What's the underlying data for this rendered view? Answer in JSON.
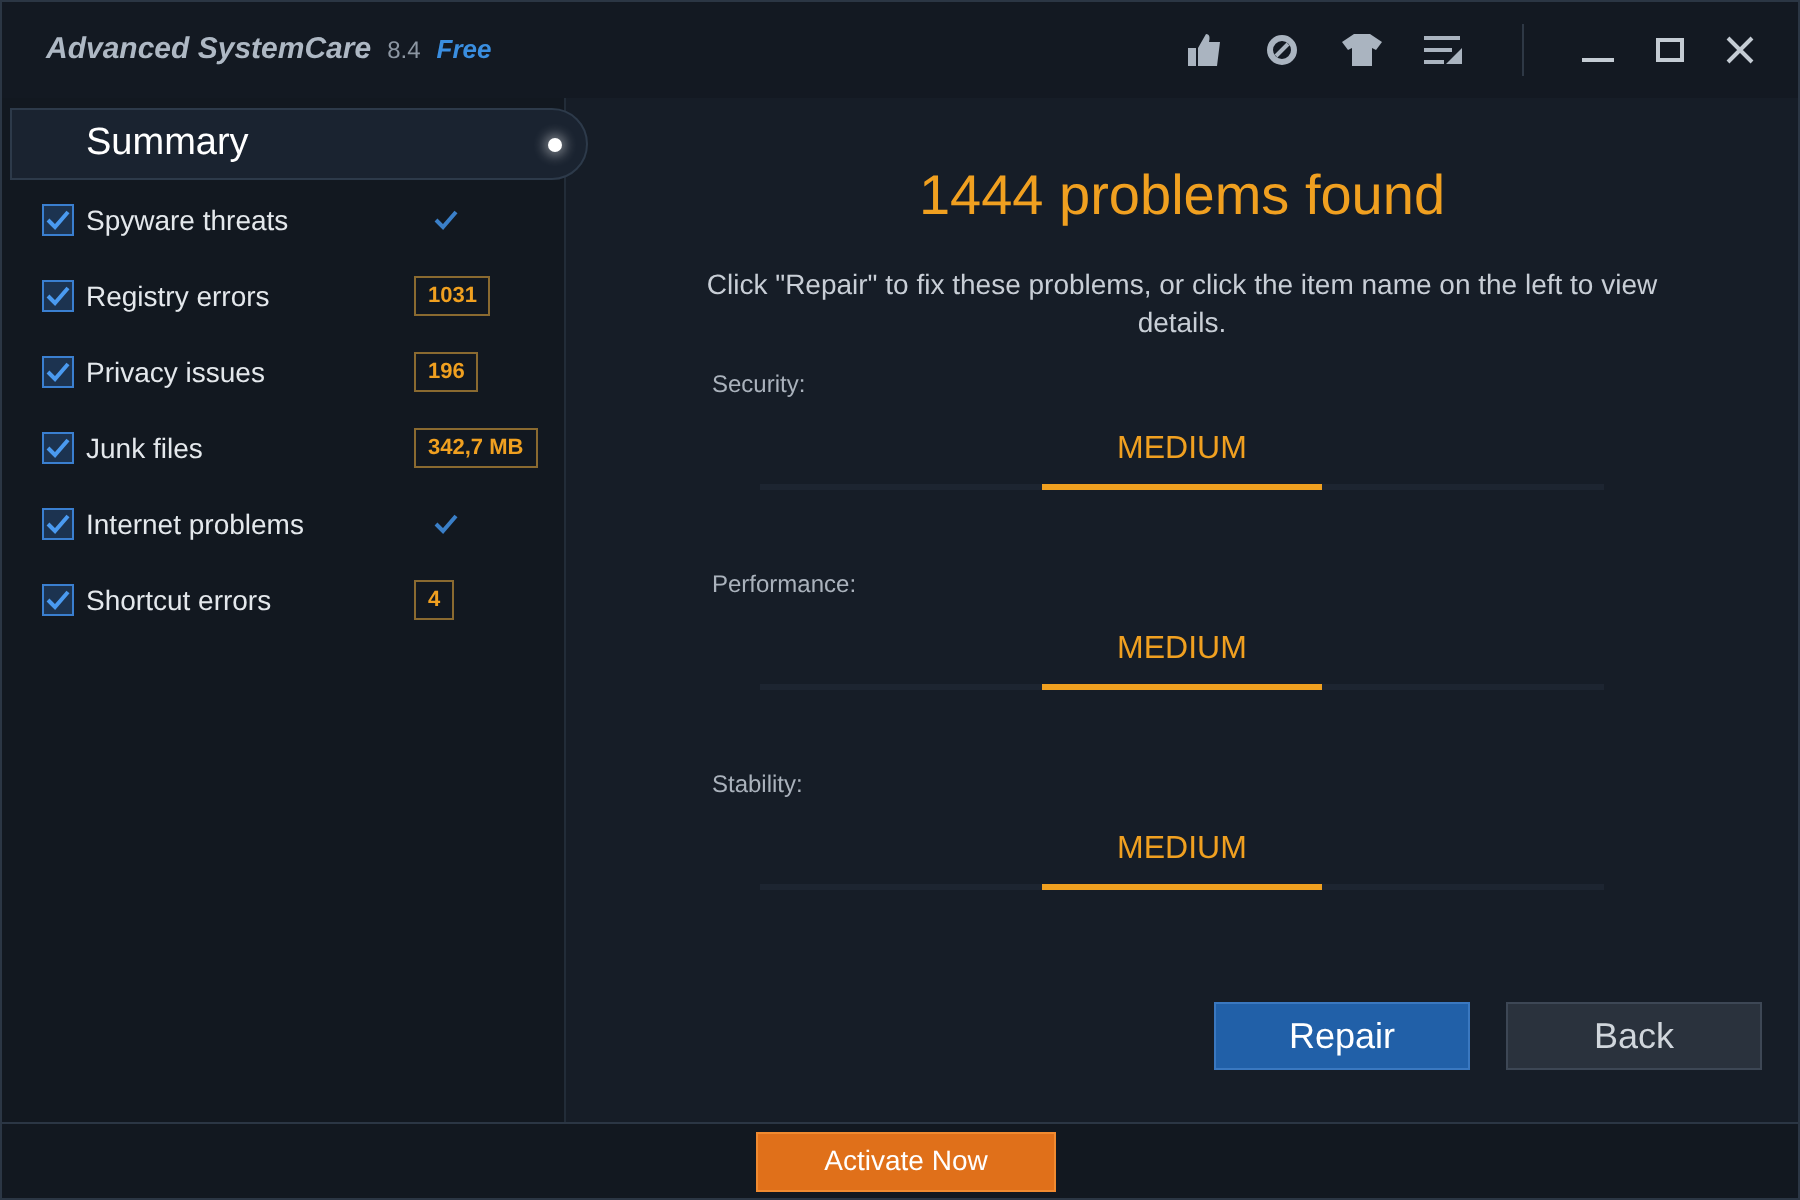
{
  "window": {
    "title": "Advanced SystemCare",
    "version": "8.4",
    "edition": "Free"
  },
  "sidebar": {
    "summary": {
      "label": "Summary",
      "selected": true
    },
    "items": [
      {
        "label": "Spyware threats",
        "checked": true,
        "kind": "clean"
      },
      {
        "label": "Registry errors",
        "checked": true,
        "kind": "count",
        "count": "1031"
      },
      {
        "label": "Privacy issues",
        "checked": true,
        "kind": "count",
        "count": "196"
      },
      {
        "label": "Junk files",
        "checked": true,
        "kind": "count",
        "count": "342,7 MB"
      },
      {
        "label": "Internet problems",
        "checked": true,
        "kind": "clean"
      },
      {
        "label": "Shortcut errors",
        "checked": true,
        "kind": "count",
        "count": "4"
      }
    ]
  },
  "main": {
    "heading": "1444 problems found",
    "description": "Click \"Repair\" to fix these problems, or click the item name on the left to view details.",
    "ratings": [
      {
        "label": "Security:",
        "value": "MEDIUM"
      },
      {
        "label": "Performance:",
        "value": "MEDIUM"
      },
      {
        "label": "Stability:",
        "value": "MEDIUM"
      }
    ],
    "buttons": [
      {
        "label": "Repair",
        "kind": "primary"
      },
      {
        "label": "Back",
        "kind": "secondary"
      }
    ]
  },
  "footer": {
    "button": "Activate Now"
  }
}
